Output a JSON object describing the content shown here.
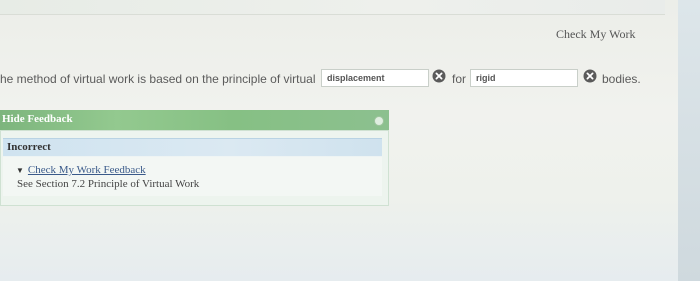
{
  "header": {
    "check_my_work_label": "Check My Work"
  },
  "question": {
    "text_before": "he method of virtual work is based on the principle of virtual",
    "blank1_value": "displacement",
    "text_between": "for",
    "blank2_value": "rigid",
    "text_after": "bodies."
  },
  "feedback": {
    "toggle_label": "Hide Feedback",
    "status": "Incorrect",
    "link_label": "Check My Work Feedback",
    "reference_text": "See Section 7.2 Principle of Virtual Work"
  },
  "colors": {
    "feedback_header": "#8cc48a",
    "incorrect_bar": "#d6e7f1",
    "wrong_icon": "#5a5a5a"
  },
  "icons": {
    "wrong_answer": "x-circle-icon",
    "close_feedback": "close-dot-icon",
    "expand": "triangle-down-icon"
  }
}
